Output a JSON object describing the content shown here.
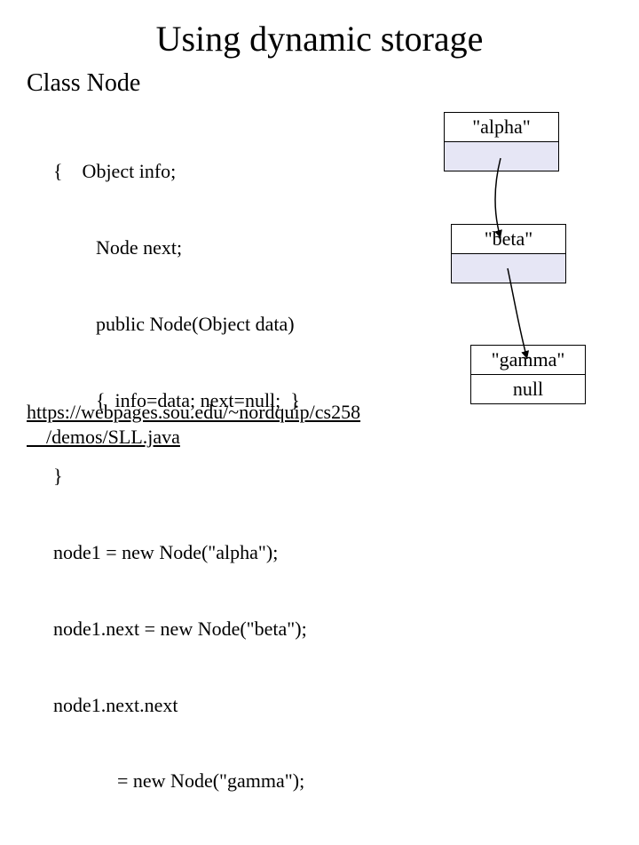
{
  "title": "Using dynamic storage",
  "subtitle": "Class Node",
  "code": {
    "l1": "{    Object info;",
    "l2": "Node next;",
    "l3": "public Node(Object data)",
    "l4": "{  info=data; next=null;  }",
    "l5": "}",
    "l6": "node1 = new Node(\"alpha\");",
    "l7": "node1.next = new Node(\"beta\");",
    "l8": "node1.next.next",
    "l9": "= new Node(\"gamma\");"
  },
  "link": {
    "line1": "https://webpages.sou.edu/~nordquip/cs258",
    "line2": "/demos/SLL.java"
  },
  "nodes": {
    "alpha": {
      "info": "\"alpha\""
    },
    "beta": {
      "info": "\"beta\""
    },
    "gamma": {
      "info": "\"gamma\"",
      "next": "null"
    }
  }
}
